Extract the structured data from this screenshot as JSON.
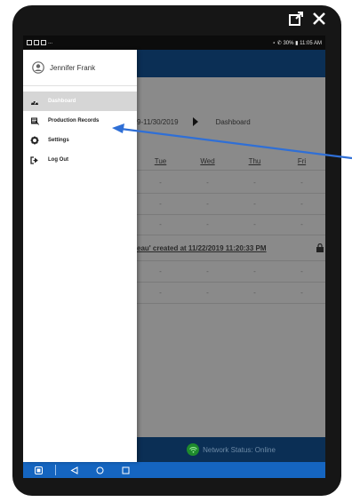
{
  "statusbar": {
    "left_text": "...",
    "right_text": "⋆ ✆ 30% ▮ 11:05 AM"
  },
  "drawer": {
    "user_name": "Jennifer Frank",
    "items": [
      {
        "label": "Dashboard",
        "icon": "dashboard-icon",
        "active": true
      },
      {
        "label": "Production Records",
        "icon": "records-icon",
        "active": false
      },
      {
        "label": "Settings",
        "icon": "gear-icon",
        "active": false
      },
      {
        "label": "Log Out",
        "icon": "logout-icon",
        "active": false
      }
    ]
  },
  "main": {
    "date_range": "9-11/30/2019",
    "dashboard_link": "Dashboard",
    "day_headers": [
      "Tue",
      "Wed",
      "Thu",
      "Fri"
    ],
    "dash": "-",
    "created_text": "eau' created at 11/22/2019 11:20:33 PM"
  },
  "footer": {
    "network_status": "Network Status: Online"
  },
  "colors": {
    "appbar": "#0b2f55",
    "navbar": "#1565c0",
    "arrow": "#2f6fd6",
    "online": "#1e8a2d"
  }
}
